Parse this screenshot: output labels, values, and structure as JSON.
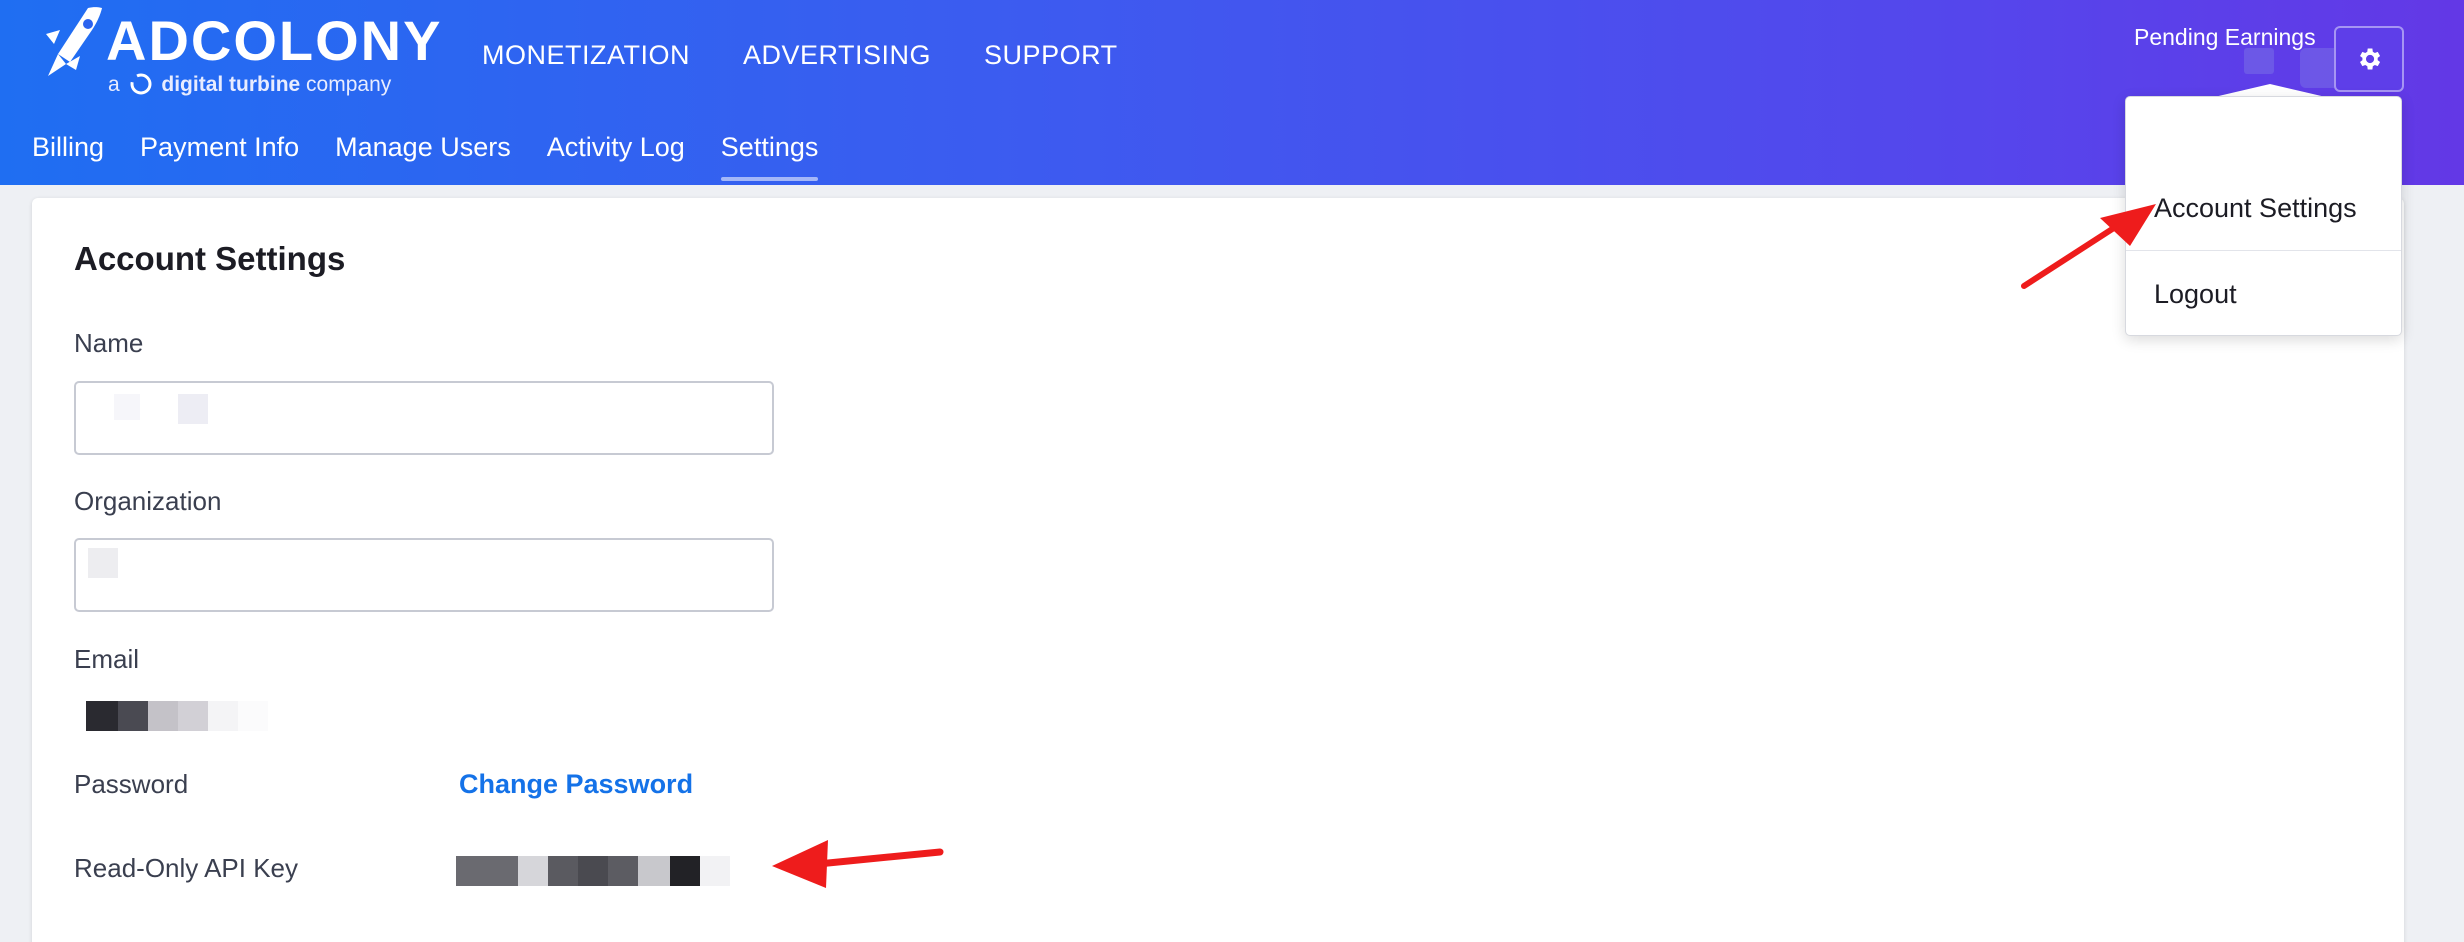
{
  "brand": {
    "logo_text": "ADCOLONY",
    "subline_prefix": "a",
    "subline_bold": "digital turbine",
    "subline_suffix": "company"
  },
  "top_nav": [
    {
      "label": "MONETIZATION"
    },
    {
      "label": "ADVERTISING"
    },
    {
      "label": "SUPPORT"
    }
  ],
  "sub_nav": [
    {
      "label": "Billing"
    },
    {
      "label": "Payment Info"
    },
    {
      "label": "Manage Users"
    },
    {
      "label": "Activity Log"
    },
    {
      "label": "Settings",
      "active": true
    }
  ],
  "header_right": {
    "pending_earnings_label": "Pending Earnings",
    "gear_icon": "gear-icon"
  },
  "dropdown": {
    "items": [
      {
        "label": "Account Settings"
      },
      {
        "label": "Logout"
      }
    ]
  },
  "account": {
    "title": "Account Settings",
    "name_label": "Name",
    "name_value": "",
    "organization_label": "Organization",
    "organization_value": "",
    "email_label": "Email",
    "password_label": "Password",
    "change_password_label": "Change Password",
    "api_key_label": "Read-Only API Key"
  },
  "colors": {
    "header_gradient_start": "#1f6ef2",
    "header_gradient_end": "#6338e6",
    "link": "#1472e8",
    "annotation_arrow": "#ee1c1c"
  }
}
